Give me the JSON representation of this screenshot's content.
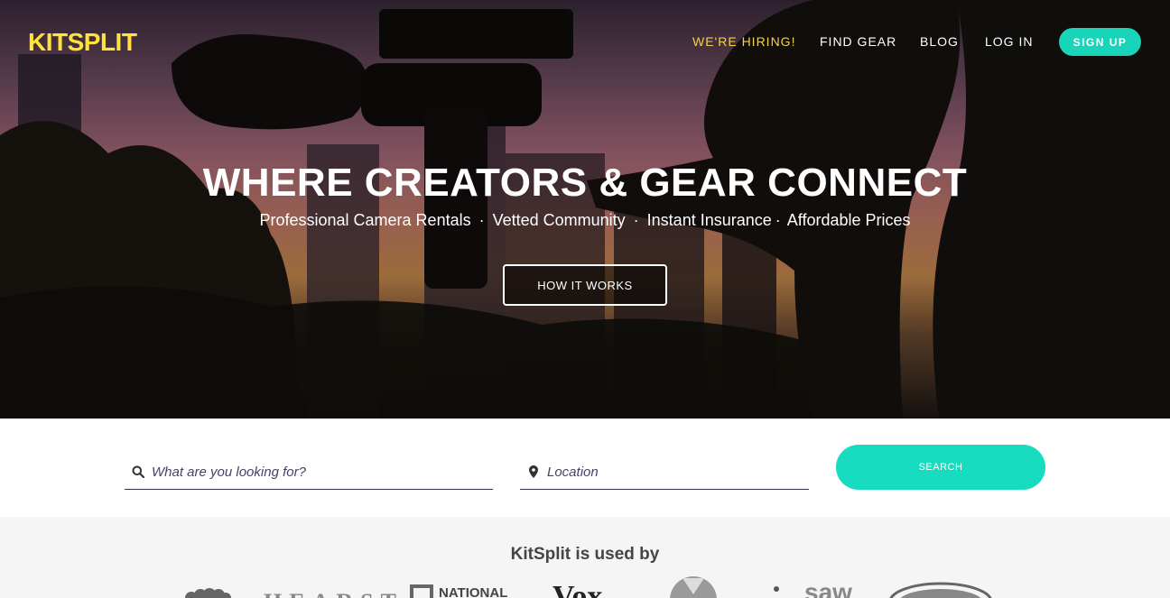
{
  "nav": {
    "logo": "KITSPLIT",
    "links": [
      {
        "label": "WE'RE HIRING!"
      },
      {
        "label": "FIND GEAR"
      },
      {
        "label": "BLOG"
      },
      {
        "label": "LOG IN"
      }
    ],
    "signup_label": "SIGN UP"
  },
  "hero": {
    "headline": "WHERE CREATORS & GEAR CONNECT",
    "features": [
      "Professional Camera Rentals",
      "Vetted Community",
      "Instant Insurance",
      "Affordable Prices"
    ],
    "separator": "·",
    "cta_label": "HOW IT WORKS"
  },
  "search": {
    "what_placeholder": "What are you looking for?",
    "where_placeholder": "Location",
    "button_label": "SEARCH"
  },
  "used_by": {
    "title": "KitSplit is used by",
    "brands": [
      "HEARST",
      "NATIONAL",
      "Vox",
      "saw"
    ]
  },
  "colors": {
    "accent": "#18dcc0",
    "logo": "#ffe33b",
    "hiring": "#f3d34a"
  },
  "icons": {
    "what": "search-icon",
    "where": "map-pin-icon"
  }
}
